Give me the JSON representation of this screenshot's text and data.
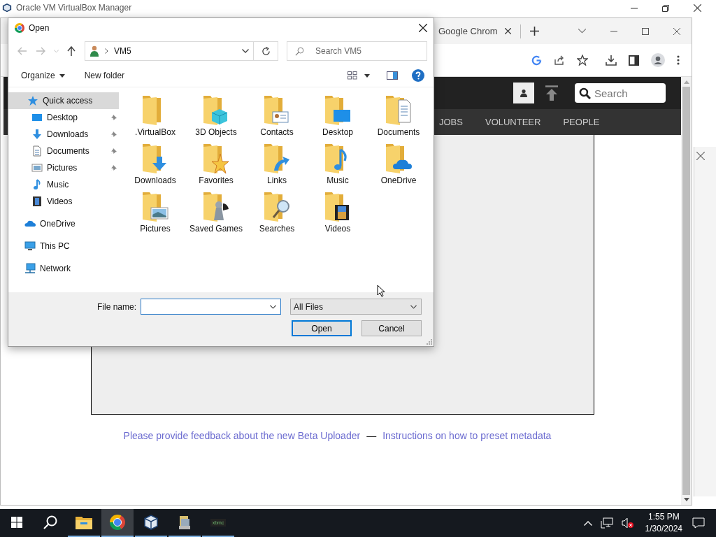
{
  "background_window": {
    "title": "Oracle VM VirtualBox Manager"
  },
  "browser": {
    "tab": {
      "title": "Google Chrom"
    },
    "page": {
      "search": {
        "placeholder": "Search"
      },
      "nav": [
        {
          "label": "JOBS"
        },
        {
          "label": "VOLUNTEER"
        },
        {
          "label": "PEOPLE"
        }
      ],
      "links": [
        {
          "label": "Please provide feedback about the new Beta Uploader"
        },
        {
          "label": "Instructions on how to preset metadata"
        }
      ],
      "separator": "—"
    }
  },
  "dialog": {
    "title": "Open",
    "address": "VM5",
    "search": {
      "placeholder": "Search VM5"
    },
    "commands": [
      {
        "label": "Organize",
        "dropdown": true
      },
      {
        "label": "New folder",
        "dropdown": false
      }
    ],
    "sidebar": [
      {
        "label": "Quick access",
        "kind": "star",
        "selected": true,
        "children": [
          {
            "label": "Desktop",
            "kind": "desktop",
            "pinned": true,
            "selected": false
          },
          {
            "label": "Downloads",
            "kind": "download",
            "pinned": true,
            "selected": false
          },
          {
            "label": "Documents",
            "kind": "document",
            "pinned": true,
            "selected": false
          },
          {
            "label": "Pictures",
            "kind": "picture",
            "pinned": true,
            "selected": false
          },
          {
            "label": "Music",
            "kind": "music",
            "pinned": false,
            "selected": false
          },
          {
            "label": "Videos",
            "kind": "video",
            "pinned": false,
            "selected": false
          }
        ]
      },
      {
        "label": "OneDrive",
        "kind": "cloud",
        "selected": false
      },
      {
        "label": "This PC",
        "kind": "pc",
        "selected": false
      },
      {
        "label": "Network",
        "kind": "network",
        "selected": false
      }
    ],
    "items": [
      {
        "label": ".VirtualBox",
        "kind": "plain"
      },
      {
        "label": "3D Objects",
        "kind": "cube"
      },
      {
        "label": "Contacts",
        "kind": "contact"
      },
      {
        "label": "Desktop",
        "kind": "desktop"
      },
      {
        "label": "Documents",
        "kind": "document"
      },
      {
        "label": "Downloads",
        "kind": "download"
      },
      {
        "label": "Favorites",
        "kind": "star"
      },
      {
        "label": "Links",
        "kind": "link"
      },
      {
        "label": "Music",
        "kind": "music"
      },
      {
        "label": "OneDrive",
        "kind": "cloud"
      },
      {
        "label": "Pictures",
        "kind": "picture"
      },
      {
        "label": "Saved Games",
        "kind": "chess"
      },
      {
        "label": "Searches",
        "kind": "search"
      },
      {
        "label": "Videos",
        "kind": "video"
      }
    ],
    "file_name": {
      "label": "File name:"
    },
    "file_type": {
      "value": "All Files"
    },
    "buttons": [
      {
        "label": "Open",
        "default": true
      },
      {
        "label": "Cancel",
        "default": false
      }
    ]
  },
  "taskbar": {
    "apps": [
      {
        "kind": "start",
        "running": false,
        "selected": false
      },
      {
        "kind": "search",
        "running": false,
        "selected": false
      },
      {
        "kind": "explorer",
        "running": true,
        "selected": false
      },
      {
        "kind": "chrome",
        "running": true,
        "selected": true
      },
      {
        "kind": "virtualbox",
        "running": true,
        "selected": false
      },
      {
        "kind": "computer",
        "running": true,
        "selected": false
      },
      {
        "kind": "xbmc",
        "label": "xbmc",
        "running": true,
        "selected": false
      }
    ],
    "clock": {
      "time": "1:55 PM",
      "date": "1/30/2024"
    }
  }
}
